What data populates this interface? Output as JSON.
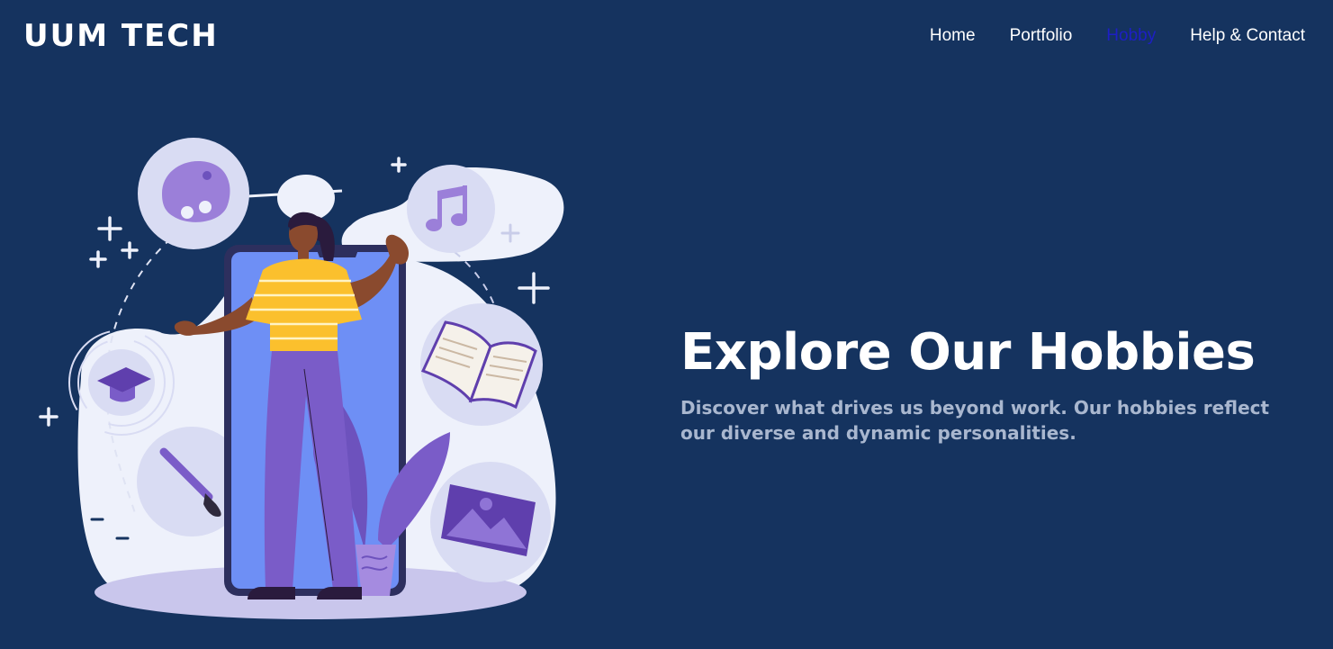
{
  "header": {
    "brand": "UUM TECH",
    "nav": [
      {
        "label": "Home",
        "active": false
      },
      {
        "label": "Portfolio",
        "active": false
      },
      {
        "label": "Hobby",
        "active": true
      },
      {
        "label": "Help & Contact",
        "active": false
      }
    ]
  },
  "hero": {
    "title": "Explore Our Hobbies",
    "subtitle": "Discover what drives us beyond work. Our hobbies reflect our diverse and dynamic personalities."
  },
  "illustration": {
    "icons": [
      "palette-icon",
      "music-note-icon",
      "book-icon",
      "graduation-cap-icon",
      "paintbrush-icon",
      "picture-icon"
    ]
  },
  "colors": {
    "background": "#15335f",
    "text": "#ffffff",
    "nav_active": "#1d1fc4",
    "subtitle": "#a9b7cf",
    "accent_purple": "#7a5cc8",
    "accent_yellow": "#fbc02d"
  }
}
